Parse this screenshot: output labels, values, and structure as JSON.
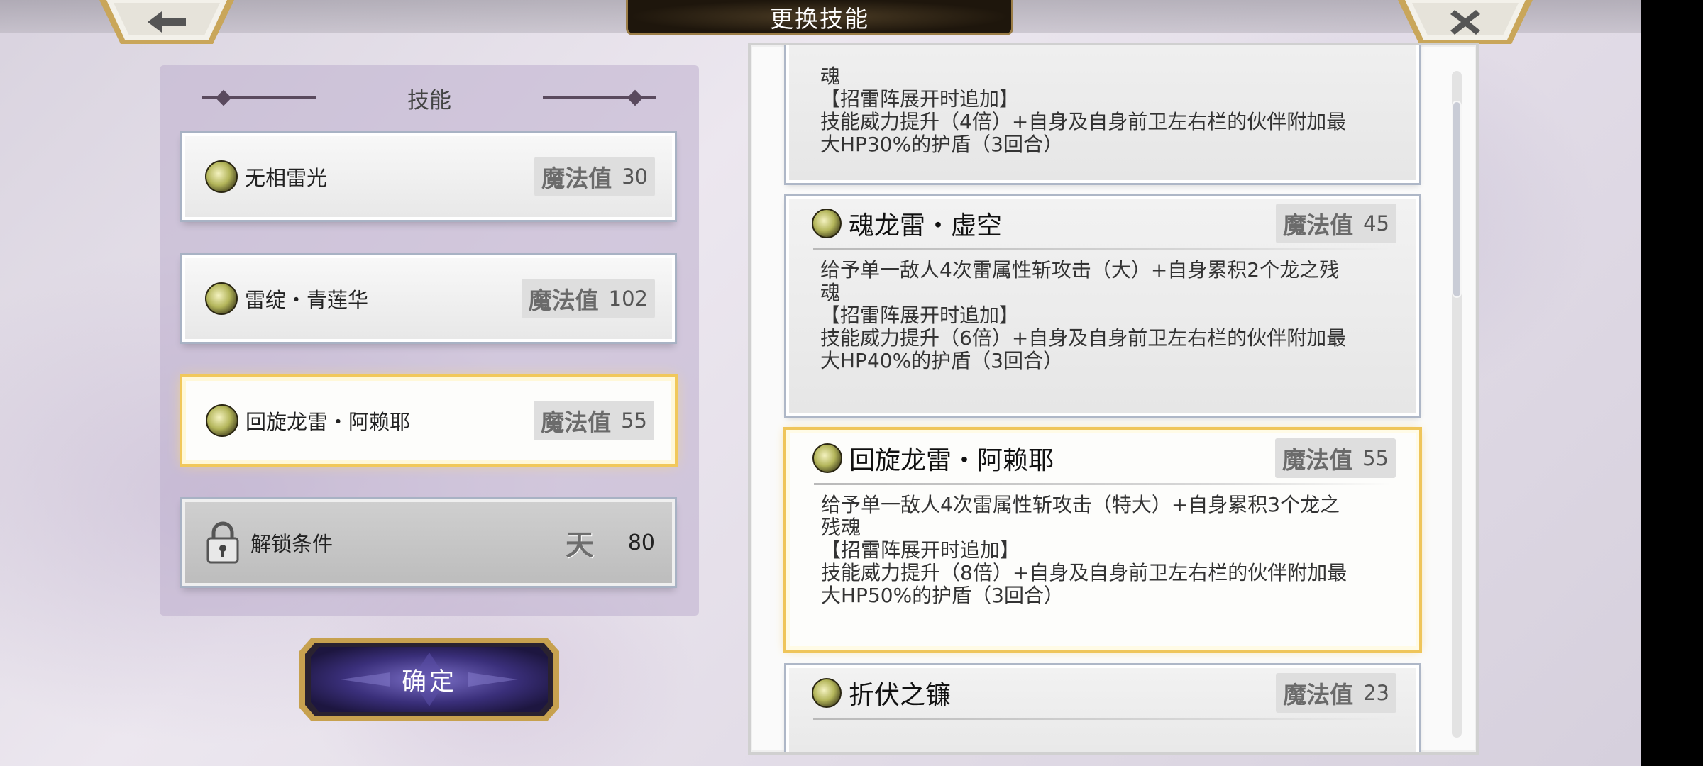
{
  "header": {
    "title": "更换技能"
  },
  "left_panel": {
    "heading": "技能",
    "slots": [
      {
        "name": "无相雷光",
        "mp_label": "魔法值",
        "mp": "30"
      },
      {
        "name": "雷绽・青莲华",
        "mp_label": "魔法值",
        "mp": "102"
      },
      {
        "name": "回旋龙雷・阿赖耶",
        "mp_label": "魔法值",
        "mp": "55",
        "selected": true
      },
      {
        "name": "解锁条件",
        "rank": "天",
        "value": "80",
        "locked": true
      }
    ],
    "confirm_label": "确定"
  },
  "skill_list": {
    "partial_top_desc": "魂\n【招雷阵展开时追加】\n技能威力提升（4倍）+自身及自身前卫左右栏的伙伴附加最\n大HP30%的护盾（3回合）",
    "cards": [
      {
        "name": "魂龙雷・虚空",
        "mp_label": "魔法值",
        "mp": "45",
        "desc": "给予单一敌人4次雷属性斩攻击（大）+自身累积2个龙之残\n魂\n【招雷阵展开时追加】\n技能威力提升（6倍）+自身及自身前卫左右栏的伙伴附加最\n大HP40%的护盾（3回合）"
      },
      {
        "name": "回旋龙雷・阿赖耶",
        "mp_label": "魔法值",
        "mp": "55",
        "selected": true,
        "desc": "给予单一敌人4次雷属性斩攻击（特大）+自身累积3个龙之\n残魂\n【招雷阵展开时追加】\n技能威力提升（8倍）+自身及自身前卫左右栏的伙伴附加最\n大HP50%的护盾（3回合）"
      },
      {
        "name": "折伏之镰",
        "mp_label": "魔法值",
        "mp": "23"
      }
    ]
  },
  "icons": {
    "back": "back-arrow-icon",
    "close": "close-x-icon",
    "skill": "thunder-orb-icon",
    "lock": "padlock-icon"
  },
  "colors": {
    "selected_border": "#efc55a",
    "title_plate": "#1e160c",
    "confirm_button": "#3a2f7a"
  }
}
